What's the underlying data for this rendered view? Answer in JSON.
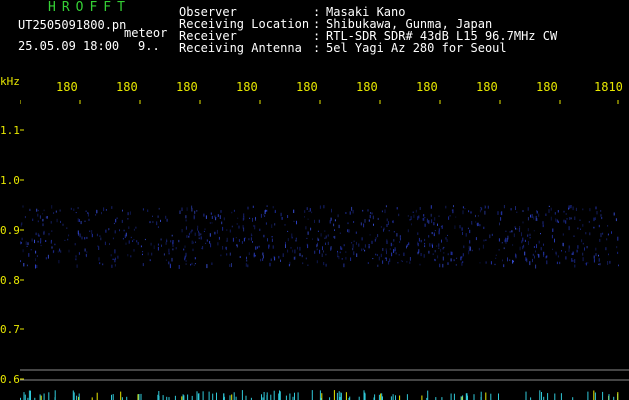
{
  "app": {
    "title": "HROFFT"
  },
  "file": {
    "name": "UT2505091800.pn",
    "type": "meteor",
    "datetime": "25.05.09 18:00",
    "count": "9.."
  },
  "header": {
    "rows": [
      {
        "label": "Observer",
        "value": "Masaki Kano"
      },
      {
        "label": "Receiving Location",
        "value": "Shibukawa, Gunma, Japan"
      },
      {
        "label": "Receiver",
        "value": "RTL-SDR SDR# 43dB L15 96.7MHz CW"
      },
      {
        "label": "Receiving Antenna",
        "value": "5el Yagi Az 280 for Seoul"
      }
    ]
  },
  "axis": {
    "unit": "kHz",
    "time_ticks": [
      "180",
      "180",
      "180",
      "180",
      "180",
      "180",
      "180",
      "180",
      "180",
      "1810"
    ],
    "freq_ticks": [
      "1.1",
      "1.0",
      "0.9",
      "0.8",
      "0.7",
      "0.6"
    ]
  },
  "colors": {
    "background": "#000000",
    "title": "#35d035",
    "label": "#e8e800",
    "text": "#ffffff",
    "signal": "#2838c8"
  }
}
